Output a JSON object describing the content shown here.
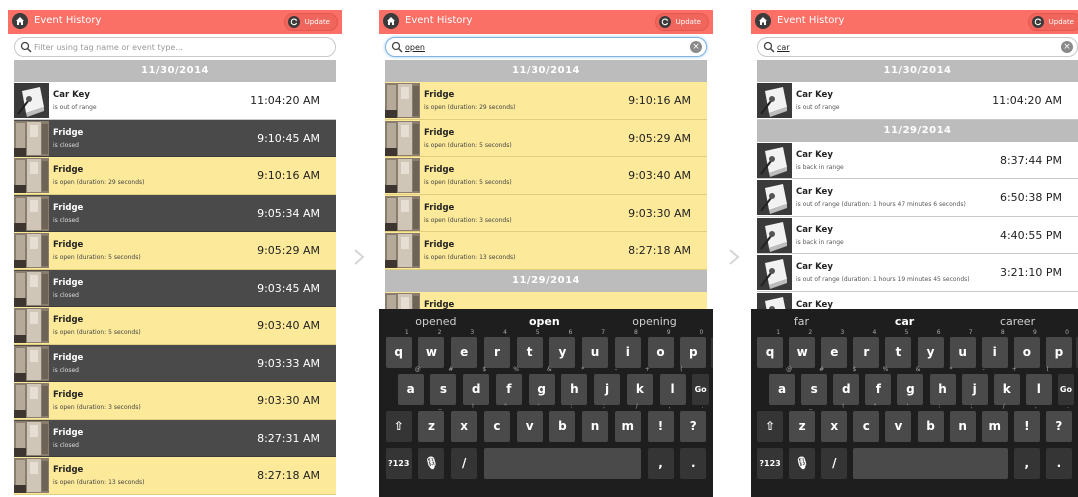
{
  "app": {
    "title": "Event History",
    "update_label": "Update",
    "search_placeholder": "Filter using tag name or event type..."
  },
  "colors": {
    "header": "#fa6f66",
    "date_bar": "#bcbcbc",
    "row_dark": "#4a4a4a",
    "row_yellow": "#fcea9a",
    "keyboard": "#1e1e1e"
  },
  "icons": {
    "home": "home-icon",
    "refresh": "refresh-icon",
    "search": "search-icon",
    "clear": "clear-icon",
    "next": "chevron-right-icon"
  },
  "screens": [
    {
      "search_value": "",
      "groups": [
        {
          "date": "11/30/2014",
          "rows": [
            {
              "name": "Car Key",
              "status": "is out of range",
              "time": "11:04:20 AM",
              "style": "white",
              "thumb": "key"
            },
            {
              "name": "Fridge",
              "status": "is closed",
              "time": "9:10:45 AM",
              "style": "dark",
              "thumb": "fridge"
            },
            {
              "name": "Fridge",
              "status": "is open (duration: 29 seconds)",
              "time": "9:10:16 AM",
              "style": "yellow",
              "thumb": "fridge"
            },
            {
              "name": "Fridge",
              "status": "is closed",
              "time": "9:05:34 AM",
              "style": "dark",
              "thumb": "fridge"
            },
            {
              "name": "Fridge",
              "status": "is open (duration: 5 seconds)",
              "time": "9:05:29 AM",
              "style": "yellow",
              "thumb": "fridge"
            },
            {
              "name": "Fridge",
              "status": "is closed",
              "time": "9:03:45 AM",
              "style": "dark",
              "thumb": "fridge"
            },
            {
              "name": "Fridge",
              "status": "is open (duration: 5 seconds)",
              "time": "9:03:40 AM",
              "style": "yellow",
              "thumb": "fridge"
            },
            {
              "name": "Fridge",
              "status": "is closed",
              "time": "9:03:33 AM",
              "style": "dark",
              "thumb": "fridge"
            },
            {
              "name": "Fridge",
              "status": "is open (duration: 3 seconds)",
              "time": "9:03:30 AM",
              "style": "yellow",
              "thumb": "fridge"
            },
            {
              "name": "Fridge",
              "status": "is closed",
              "time": "8:27:31 AM",
              "style": "dark",
              "thumb": "fridge"
            },
            {
              "name": "Fridge",
              "status": "is open (duration: 13 seconds)",
              "time": "8:27:18 AM",
              "style": "yellow",
              "thumb": "fridge"
            }
          ]
        }
      ]
    },
    {
      "search_value": "open",
      "groups": [
        {
          "date": "11/30/2014",
          "rows": [
            {
              "name": "Fridge",
              "status": "is open (duration: 29 seconds)",
              "time": "9:10:16 AM",
              "style": "yellow",
              "thumb": "fridge"
            },
            {
              "name": "Fridge",
              "status": "is open (duration: 5 seconds)",
              "time": "9:05:29 AM",
              "style": "yellow",
              "thumb": "fridge"
            },
            {
              "name": "Fridge",
              "status": "is open (duration: 5 seconds)",
              "time": "9:03:40 AM",
              "style": "yellow",
              "thumb": "fridge"
            },
            {
              "name": "Fridge",
              "status": "is open (duration: 3 seconds)",
              "time": "9:03:30 AM",
              "style": "yellow",
              "thumb": "fridge"
            },
            {
              "name": "Fridge",
              "status": "is open (duration: 13 seconds)",
              "time": "8:27:18 AM",
              "style": "yellow",
              "thumb": "fridge"
            }
          ]
        },
        {
          "date": "11/29/2014",
          "rows": [
            {
              "name": "Fridge",
              "status": "",
              "time": "",
              "style": "yellow",
              "thumb": "fridge"
            }
          ]
        }
      ],
      "suggestions": [
        "opened",
        "open",
        "opening"
      ]
    },
    {
      "search_value": "car",
      "groups": [
        {
          "date": "11/30/2014",
          "rows": [
            {
              "name": "Car Key",
              "status": "is out of range",
              "time": "11:04:20 AM",
              "style": "white",
              "thumb": "key"
            }
          ]
        },
        {
          "date": "11/29/2014",
          "rows": [
            {
              "name": "Car Key",
              "status": "is back in range",
              "time": "8:37:44 PM",
              "style": "white",
              "thumb": "key"
            },
            {
              "name": "Car Key",
              "status": "is out of range (duration: 1 hours 47 minutes 6 seconds)",
              "time": "6:50:38 PM",
              "style": "white",
              "thumb": "key"
            },
            {
              "name": "Car Key",
              "status": "is back in range",
              "time": "4:40:55 PM",
              "style": "white",
              "thumb": "key"
            },
            {
              "name": "Car Key",
              "status": "is out of range (duration: 1 hours 19 minutes 45 seconds)",
              "time": "3:21:10 PM",
              "style": "white",
              "thumb": "key"
            },
            {
              "name": "Car Key",
              "status": "",
              "time": "",
              "style": "white",
              "thumb": "key"
            }
          ]
        }
      ],
      "suggestions": [
        "far",
        "car",
        "career"
      ]
    }
  ],
  "keyboard": {
    "row1": [
      {
        "k": "q",
        "s": "1"
      },
      {
        "k": "w",
        "s": "2"
      },
      {
        "k": "e",
        "s": "3"
      },
      {
        "k": "r",
        "s": "4"
      },
      {
        "k": "t",
        "s": "5"
      },
      {
        "k": "y",
        "s": "6"
      },
      {
        "k": "u",
        "s": "7"
      },
      {
        "k": "i",
        "s": "8"
      },
      {
        "k": "o",
        "s": "9"
      },
      {
        "k": "p",
        "s": "0"
      }
    ],
    "row2": [
      {
        "k": "a",
        "s": "@"
      },
      {
        "k": "s",
        "s": "#"
      },
      {
        "k": "d",
        "s": "$"
      },
      {
        "k": "f",
        "s": "%"
      },
      {
        "k": "g",
        "s": "&"
      },
      {
        "k": "h",
        "s": "*"
      },
      {
        "k": "j",
        "s": "-"
      },
      {
        "k": "k",
        "s": "+"
      },
      {
        "k": "l",
        "s": "("
      }
    ],
    "row3": [
      {
        "k": "z",
        "s": "_"
      },
      {
        "k": "x",
        "s": "!"
      },
      {
        "k": "c",
        "s": "\""
      },
      {
        "k": "v",
        "s": "'"
      },
      {
        "k": "b",
        "s": ":"
      },
      {
        "k": "n",
        "s": ";"
      },
      {
        "k": "m",
        "s": "/"
      },
      {
        "k": "!",
        "s": ","
      },
      {
        "k": "?",
        "s": "."
      }
    ],
    "go_label": "Go",
    "symbols_label": "?123",
    "slash_label": "/",
    "comma_label": ",",
    "period_label": ".",
    "backspace_icon": "backspace-icon",
    "shift_icon": "shift-icon",
    "mic_icon": "mic-icon",
    "emoji_icon": "emoji-icon"
  }
}
